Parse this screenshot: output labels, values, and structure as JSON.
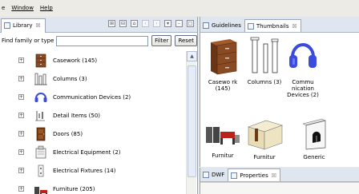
{
  "menubar": {
    "items": [
      {
        "label": "e"
      },
      {
        "label": "Window"
      },
      {
        "label": "Help"
      }
    ]
  },
  "library": {
    "tab_label": "Library",
    "tab_close": "☒",
    "find_label": "Find family or type",
    "find_value": "",
    "filter_label": "Filter",
    "reset_label": "Reset",
    "items": [
      {
        "label": "Casework (145)",
        "icon": "cabinet-icon"
      },
      {
        "label": "Columns (3)",
        "icon": "column-icon"
      },
      {
        "label": "Communication Devices (2)",
        "icon": "headset-icon"
      },
      {
        "label": "Detail Items (50)",
        "icon": "detail-item-icon"
      },
      {
        "label": "Doors (85)",
        "icon": "door-icon"
      },
      {
        "label": "Electrical Equipment (2)",
        "icon": "electrical-equipment-icon"
      },
      {
        "label": "Electrical Fixtures (14)",
        "icon": "electrical-fixture-icon"
      },
      {
        "label": "Furniture (205)",
        "icon": "furniture-icon"
      }
    ],
    "expander_symbol": "+"
  },
  "top_panel": {
    "tabs": [
      {
        "label": "Guidelines",
        "active": false
      },
      {
        "label": "Thumbnails",
        "active": true,
        "close": "☒"
      }
    ],
    "thumbnails": [
      {
        "label": "Casewo rk (145)",
        "icon": "cabinet-thumbnail"
      },
      {
        "label": "Columns (3)",
        "icon": "columns-thumbnail"
      },
      {
        "label": "Commu nication Devices (2)",
        "icon": "headset-thumbnail"
      },
      {
        "label": "Furnitur",
        "icon": "furniture-set-thumbnail"
      },
      {
        "label": "Furnitur",
        "icon": "cubicle-thumbnail"
      },
      {
        "label": "Generic",
        "icon": "generic-thumbnail"
      }
    ]
  },
  "bottom_panel": {
    "tabs": [
      {
        "label": "DWF",
        "active": false
      },
      {
        "label": "Properties",
        "active": true,
        "close": "☒"
      }
    ]
  },
  "colors": {
    "tab_bar": "#dfe6ef",
    "accent_blue": "#3b4bdb",
    "cabinet_brown": "#8a4b22"
  }
}
